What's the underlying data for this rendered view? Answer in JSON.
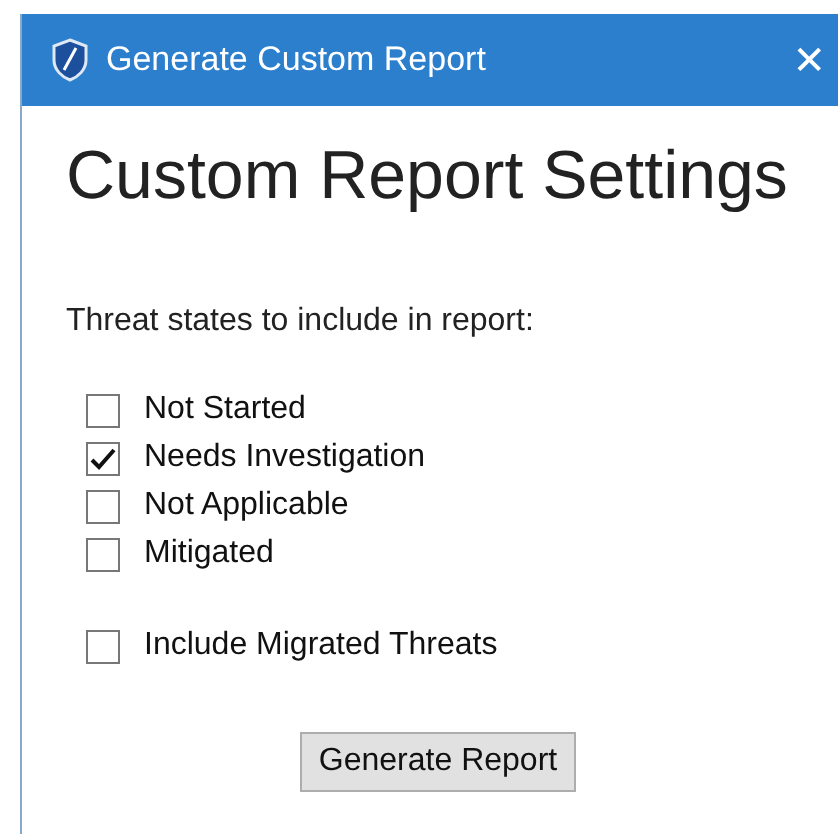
{
  "window": {
    "title": "Generate Custom Report",
    "close": "✕"
  },
  "heading": "Custom Report Settings",
  "prompt": "Threat states to include in report:",
  "states": [
    {
      "label": "Not Started",
      "checked": false
    },
    {
      "label": "Needs Investigation",
      "checked": true
    },
    {
      "label": "Not Applicable",
      "checked": false
    },
    {
      "label": "Mitigated",
      "checked": false
    }
  ],
  "include_migrated": {
    "label": "Include Migrated Threats",
    "checked": false
  },
  "buttons": [
    "Generate Report"
  ]
}
